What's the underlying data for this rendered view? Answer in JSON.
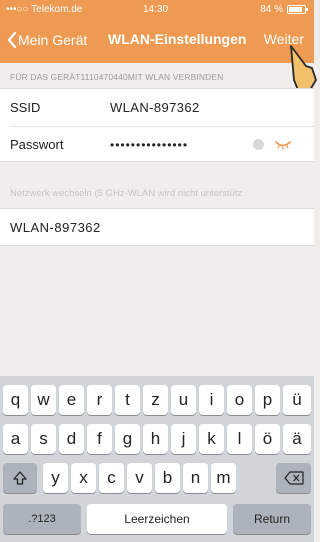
{
  "status": {
    "carrier": "•••○○ Telekom.de",
    "time": "14:30",
    "battery": "84 %"
  },
  "nav": {
    "back_label": "Mein Gerät",
    "title": "WLAN-Einstellungen",
    "next_label": "Weiter"
  },
  "section1": {
    "header": "FÜR DAS GERÄT1110470440MIT WLAN VERBINDEN"
  },
  "fields": [
    {
      "label": "SSID",
      "value": "WLAN-897362"
    },
    {
      "label": "Passwort",
      "value": "•••••••••••••••"
    }
  ],
  "section2": {
    "header": "Netzwerk wechseln (5 GHz-WLAN wird nicht unterstütz"
  },
  "networks": [
    "WLAN-897362"
  ],
  "keyboard": {
    "row1": [
      "q",
      "w",
      "e",
      "r",
      "t",
      "z",
      "u",
      "i",
      "o",
      "p",
      "ü"
    ],
    "row2": [
      "a",
      "s",
      "d",
      "f",
      "g",
      "h",
      "j",
      "k",
      "l",
      "ö",
      "ä"
    ],
    "row3": [
      "y",
      "x",
      "c",
      "v",
      "b",
      "n",
      "m"
    ],
    "mode_label": ".?123",
    "space_label": "Leerzeichen",
    "return_label": "Return"
  },
  "colors": {
    "accent": "#ee9a52"
  }
}
